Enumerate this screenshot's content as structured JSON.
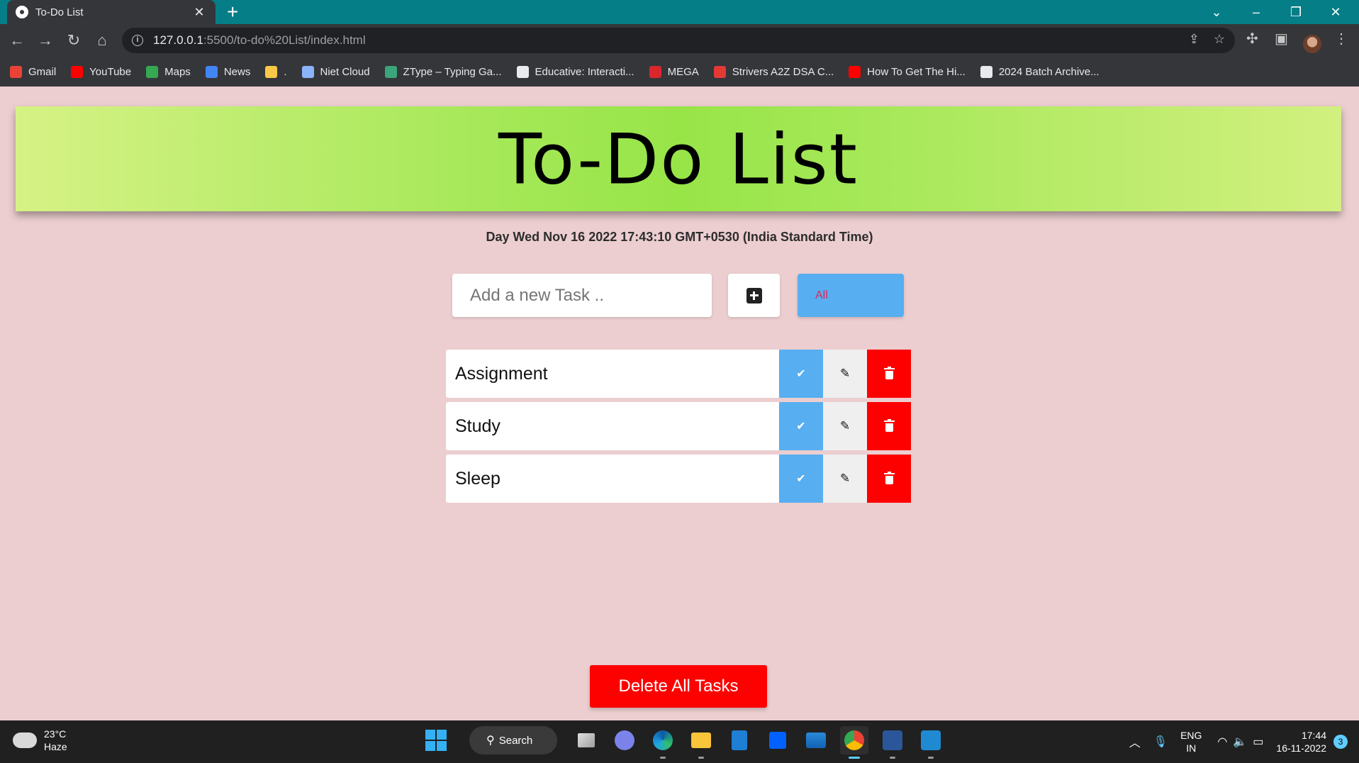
{
  "browser": {
    "tab_title": "To-Do List",
    "url_host": "127.0.0.1",
    "url_rest": ":5500/to-do%20List/index.html",
    "bookmarks": [
      {
        "label": "Gmail",
        "color": "#ea4335"
      },
      {
        "label": "YouTube",
        "color": "#ff0000"
      },
      {
        "label": "Maps",
        "color": "#34a853"
      },
      {
        "label": "News",
        "color": "#4285f4"
      },
      {
        "label": ".",
        "color": "#f9c846"
      },
      {
        "label": "Niet Cloud",
        "color": "#8ab4f8"
      },
      {
        "label": "ZType – Typing Ga...",
        "color": "#3aa57a"
      },
      {
        "label": "Educative: Interacti...",
        "color": "#e8eaed"
      },
      {
        "label": "MEGA",
        "color": "#d9272e"
      },
      {
        "label": "Strivers A2Z DSA C...",
        "color": "#e53935"
      },
      {
        "label": "How To Get The Hi...",
        "color": "#ff0000"
      },
      {
        "label": "2024 Batch Archive...",
        "color": "#e8eaed"
      }
    ]
  },
  "page": {
    "title": "To-Do List",
    "datetime": "Day Wed Nov 16 2022 17:43:10 GMT+0530 (India Standard Time)",
    "input_placeholder": "Add a new Task ..",
    "filter_label": "All",
    "tasks": [
      {
        "label": "Assignment"
      },
      {
        "label": "Study"
      },
      {
        "label": "Sleep"
      }
    ],
    "delete_all_label": "Delete All Tasks"
  },
  "taskbar": {
    "temperature": "23°C",
    "weather": "Haze",
    "search_label": "Search",
    "lang_top": "ENG",
    "lang_bottom": "IN",
    "time": "17:44",
    "date": "16-11-2022",
    "notifications": "3"
  }
}
